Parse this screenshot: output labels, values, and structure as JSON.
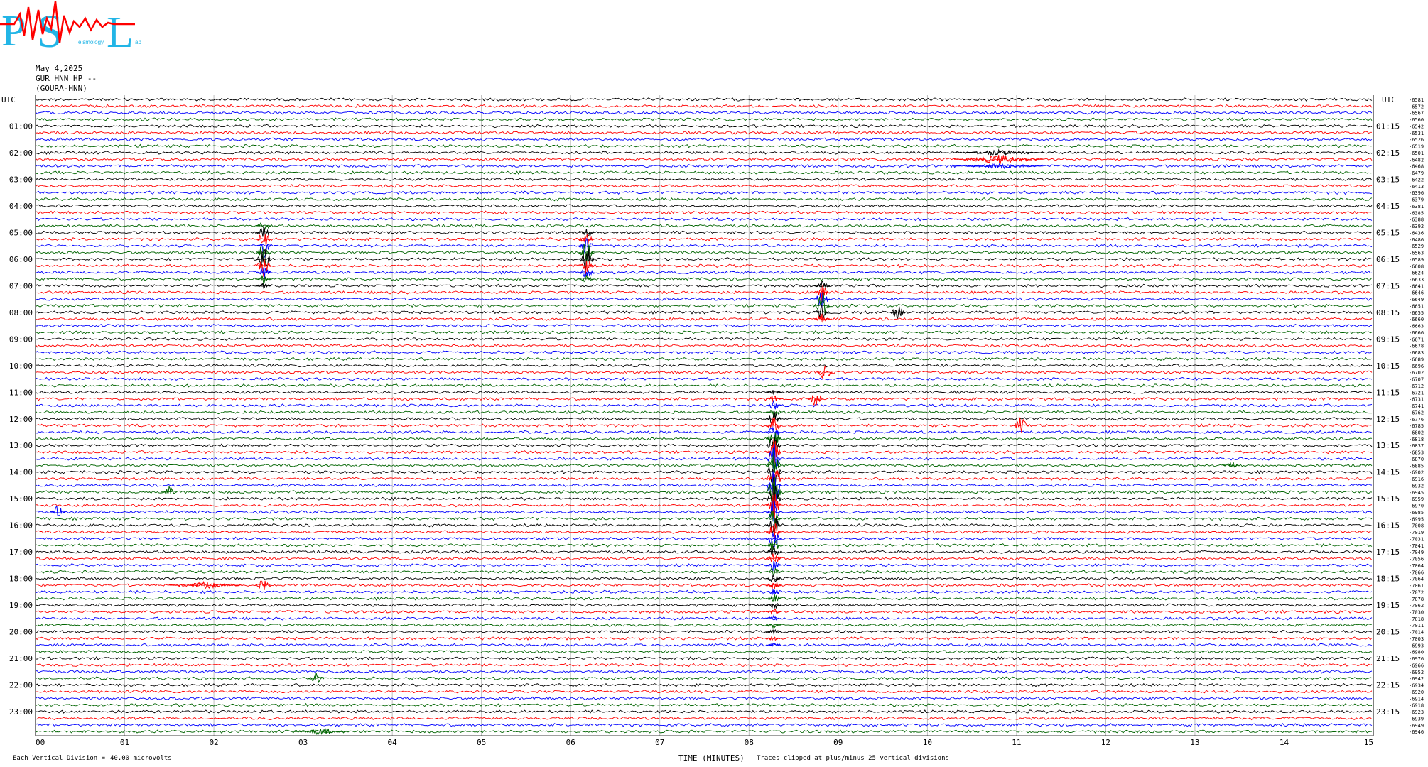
{
  "logo": {
    "letters": [
      "P",
      "S",
      "L"
    ],
    "small_text": "eismology",
    "small_text2": "ab",
    "colors": {
      "letters": "#22b5e6",
      "wave": "#ff0000"
    }
  },
  "header": {
    "date": "May 4,2025",
    "station": "GUR HNN HP --",
    "site": "(GOURA-HNN)"
  },
  "footer": {
    "division_label": "Each Vertical Division =",
    "division_value": "40.00 microvolts",
    "x_title": "TIME (MINUTES)",
    "clip_note": "Traces clipped at plus/minus 25 vertical divisions"
  },
  "chart_data": {
    "type": "line",
    "left_axis_label": "UTC",
    "right_axis_label": "UTC",
    "xlim": [
      0,
      15
    ],
    "x_ticks": [
      "00",
      "01",
      "02",
      "03",
      "04",
      "05",
      "06",
      "07",
      "08",
      "09",
      "10",
      "11",
      "12",
      "13",
      "14",
      "15"
    ],
    "rows": 96,
    "row_minutes": 15,
    "trace_colors": [
      "#000000",
      "#ff0000",
      "#0000ff",
      "#006400"
    ],
    "left_labels": [
      "01:00",
      "02:00",
      "03:00",
      "04:00",
      "05:00",
      "06:00",
      "07:00",
      "08:00",
      "09:00",
      "10:00",
      "11:00",
      "12:00",
      "13:00",
      "14:00",
      "15:00",
      "16:00",
      "17:00",
      "18:00",
      "19:00",
      "20:00",
      "21:00",
      "22:00",
      "23:00"
    ],
    "right_labels": [
      "01:15",
      "02:15",
      "03:15",
      "04:15",
      "05:15",
      "06:15",
      "07:15",
      "08:15",
      "09:15",
      "10:15",
      "11:15",
      "12:15",
      "13:15",
      "14:15",
      "15:15",
      "16:15",
      "17:15",
      "18:15",
      "19:15",
      "20:15",
      "21:15",
      "22:15",
      "23:15"
    ],
    "offsets": [
      -6581,
      -6572,
      -6567,
      -6560,
      -6542,
      -6531,
      -6526,
      -6519,
      -6501,
      -6482,
      -6468,
      -6479,
      -6422,
      -6413,
      -6396,
      -6379,
      -6381,
      -6385,
      -6388,
      -6392,
      -6436,
      -6486,
      -6529,
      -6563,
      -6589,
      -6608,
      -6624,
      -6633,
      -6641,
      -6646,
      -6649,
      -6651,
      -6655,
      -6660,
      -6663,
      -6666,
      -6671,
      -6678,
      -6683,
      -6689,
      -6696,
      -6702,
      -6707,
      -6712,
      -6721,
      -6731,
      -6741,
      -6762,
      -6776,
      -6785,
      -6802,
      -6818,
      -6837,
      -6853,
      -6870,
      -6885,
      -6902,
      -6916,
      -6932,
      -6945,
      -6959,
      -6970,
      -6985,
      -6995,
      -7008,
      -7019,
      -7031,
      -7041,
      -7049,
      -7056,
      -7064,
      -7066,
      -7064,
      -7061,
      -7072,
      -7078,
      -7062,
      -7030,
      -7018,
      -7011,
      -7014,
      -7003,
      -6993,
      -6980,
      -6976,
      -6966,
      -6952,
      -6942,
      -6934,
      -6920,
      -6914,
      -6918,
      -6923,
      -6939,
      -6949,
      -6946
    ],
    "events": [
      {
        "rows": [
          19,
          20,
          21,
          22,
          23,
          24,
          25,
          26,
          27,
          28
        ],
        "x": 2.56,
        "amp": [
          10,
          14,
          16,
          18,
          22,
          24,
          18,
          12,
          8,
          5
        ],
        "color_row": 27
      },
      {
        "rows": [
          20,
          21,
          22,
          23,
          24,
          25,
          26,
          27
        ],
        "x": 6.18,
        "amp": [
          8,
          12,
          16,
          20,
          22,
          16,
          10,
          6
        ]
      },
      {
        "rows": [
          8,
          9,
          10
        ],
        "x": 10.8,
        "amp": [
          4,
          7,
          4
        ],
        "wide": 1.0
      },
      {
        "rows": [
          28,
          29,
          30,
          31,
          32,
          33
        ],
        "x": 8.82,
        "amp": [
          8,
          14,
          20,
          26,
          14,
          8
        ]
      },
      {
        "rows": [
          32
        ],
        "x": 9.67,
        "amp": [
          14
        ]
      },
      {
        "rows": [
          41
        ],
        "x": 8.85,
        "amp": [
          14
        ]
      },
      {
        "rows": [
          45
        ],
        "x": 8.75,
        "amp": [
          12
        ]
      },
      {
        "rows": [
          49
        ],
        "x": 11.05,
        "amp": [
          14
        ]
      },
      {
        "rows": [
          44,
          45,
          46,
          47,
          48,
          49,
          50,
          51,
          52,
          53,
          54,
          55,
          56,
          57,
          58,
          59,
          60,
          61,
          62,
          63,
          64,
          65,
          66,
          67,
          68,
          69,
          70,
          71,
          72,
          73,
          74,
          75,
          76,
          77,
          78,
          79,
          80,
          81,
          82
        ],
        "x": 8.28,
        "amp": [
          4,
          6,
          8,
          10,
          12,
          14,
          16,
          18,
          20,
          22,
          24,
          26,
          28,
          30,
          34,
          40,
          30,
          26,
          22,
          20,
          18,
          16,
          14,
          12,
          10,
          10,
          9,
          9,
          8,
          8,
          7,
          7,
          6,
          6,
          5,
          5,
          4,
          4,
          3
        ]
      },
      {
        "rows": [
          62
        ],
        "x": 0.25,
        "amp": [
          10
        ]
      },
      {
        "rows": [
          59
        ],
        "x": 1.5,
        "amp": [
          8
        ]
      },
      {
        "rows": [
          73
        ],
        "x": 2.55,
        "amp": [
          10
        ]
      },
      {
        "rows": [
          73
        ],
        "x": 1.9,
        "amp": [
          5
        ],
        "wide": 0.8
      },
      {
        "rows": [
          87
        ],
        "x": 3.15,
        "amp": [
          12
        ]
      },
      {
        "rows": [
          95
        ],
        "x": 3.2,
        "amp": [
          5
        ],
        "wide": 0.6
      },
      {
        "rows": [
          55
        ],
        "x": 13.4,
        "amp": [
          8
        ]
      }
    ]
  }
}
